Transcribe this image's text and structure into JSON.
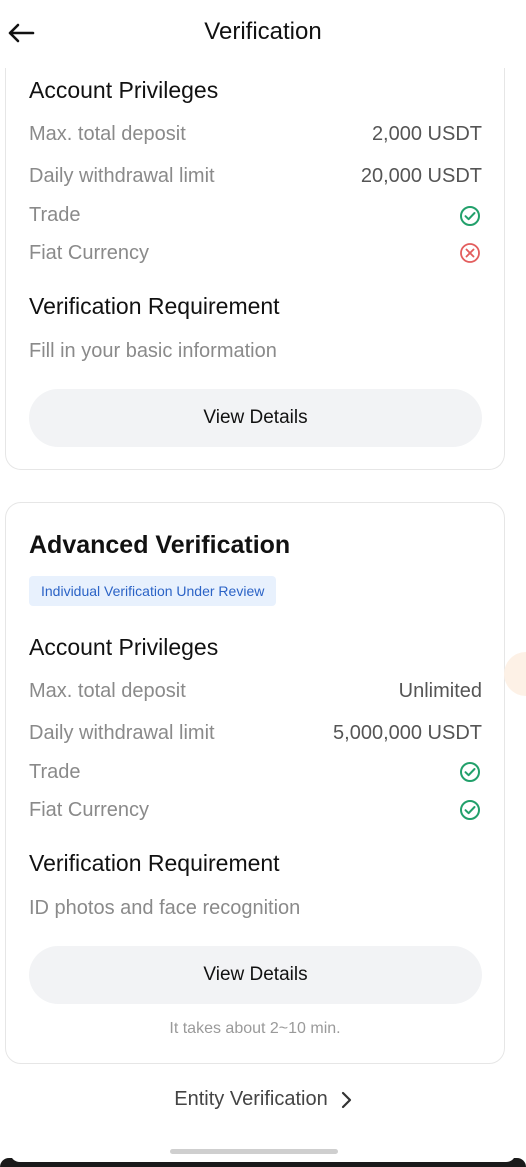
{
  "header": {
    "title": "Verification"
  },
  "basic_card": {
    "privileges_title": "Account Privileges",
    "rows": [
      {
        "label": "Max. total deposit",
        "value": "2,000 USDT"
      },
      {
        "label": "Daily withdrawal limit",
        "value": "20,000 USDT"
      }
    ],
    "trade": {
      "label": "Trade",
      "status": "allowed"
    },
    "fiat": {
      "label": "Fiat Currency",
      "status": "not-allowed"
    },
    "requirement_title": "Verification Requirement",
    "requirement_text": "Fill in your basic information",
    "button_label": "View Details"
  },
  "advanced_card": {
    "title": "Advanced Verification",
    "badge": "Individual Verification Under Review",
    "privileges_title": "Account Privileges",
    "rows": [
      {
        "label": "Max. total deposit",
        "value": "Unlimited"
      },
      {
        "label": "Daily withdrawal limit",
        "value": "5,000,000 USDT"
      }
    ],
    "trade": {
      "label": "Trade",
      "status": "allowed"
    },
    "fiat": {
      "label": "Fiat Currency",
      "status": "allowed"
    },
    "requirement_title": "Verification Requirement",
    "requirement_text": "ID photos and face recognition",
    "button_label": "View Details",
    "time_note": "It takes about 2~10 min."
  },
  "footer": {
    "entity_link": "Entity Verification"
  },
  "colors": {
    "success": "#22a06b",
    "error": "#e35d5d",
    "badge_bg": "#e8f1fd",
    "badge_text": "#2b63c6"
  }
}
